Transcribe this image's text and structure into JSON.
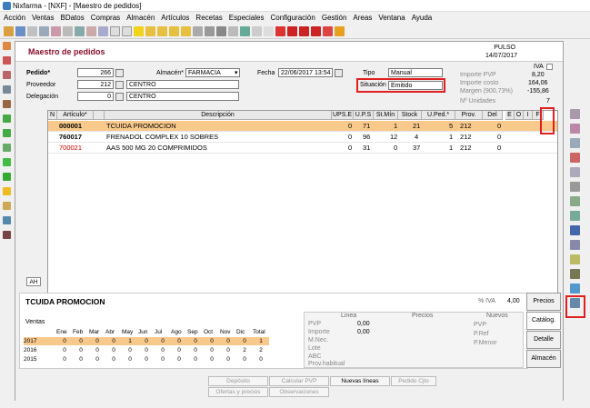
{
  "window": {
    "title": "Nixfarma - [NXF] - [Maestro de pedidos]"
  },
  "menu": [
    "Acción",
    "Ventas",
    "BDatos",
    "Compras",
    "Almacén",
    "Artículos",
    "Recetas",
    "Especiales",
    "Configuración",
    "Gestión",
    "Areas",
    "Ventana",
    "Ayuda"
  ],
  "form": {
    "title": "Maestro de pedidos",
    "user": "PULSO",
    "date": "14/07/2017",
    "pedido_label": "Pedido*",
    "pedido": "266",
    "proveedor_label": "Proveedor",
    "proveedor": "212",
    "proveedor_name": "CENTRO",
    "delegacion_label": "Delegación",
    "delegacion": "0",
    "delegacion_name": "CENTRO",
    "almacen_label": "Almacén*",
    "almacen": "FARMACIA",
    "fecha_label": "Fecha",
    "fecha": "22/06/2017 13:54",
    "tipo_label": "Tipo",
    "tipo": "Manual",
    "situacion_label": "Situación",
    "situacion": "Emitido",
    "iva_label": "IVA",
    "importe_pvp_label": "Importe PVP",
    "importe_pvp": "8,20",
    "importe_costo_label": "Importe costo",
    "importe_costo": "164,06",
    "margen_label": "Margen (900,73%)",
    "margen": "-155,86",
    "unidades_label": "Nº Unidades",
    "unidades": "7"
  },
  "grid": {
    "headers": [
      "N",
      "Artículo*",
      "Descripción",
      "UPS.E",
      "U.P.S",
      "St.Mín",
      "Stock",
      "U.Ped.*",
      "Prov.",
      "Del",
      "E",
      "O",
      "I",
      "F"
    ],
    "rows": [
      {
        "code": "000001",
        "desc": "TCUIDA PROMOCION",
        "upse": "0",
        "ups": "71",
        "stmin": "1",
        "stock": "21",
        "uped": "5",
        "prov": "212",
        "del": "0"
      },
      {
        "code": "760017",
        "desc": "FRENADOL COMPLEX 10 SOBRES",
        "upse": "0",
        "ups": "96",
        "stmin": "12",
        "stock": "4",
        "uped": "1",
        "prov": "212",
        "del": "0"
      },
      {
        "code": "700021",
        "desc": "AAS 500 MG 20 COMPRIMIDOS",
        "upse": "0",
        "ups": "31",
        "stmin": "0",
        "stock": "37",
        "uped": "1",
        "prov": "212",
        "del": "0"
      }
    ],
    "ah_tab": "AH"
  },
  "detail": {
    "title": "TCUIDA PROMOCION",
    "iva_label": "% IVA",
    "iva": "4,00",
    "ventas_label": "Ventas",
    "months": [
      "Ene",
      "Feb",
      "Mar",
      "Abr",
      "May",
      "Jun",
      "Jul",
      "Ago",
      "Sep",
      "Oct",
      "Nov",
      "Dic",
      "Total"
    ],
    "years": [
      {
        "year": "2017",
        "vals": [
          "0",
          "0",
          "0",
          "0",
          "1",
          "0",
          "0",
          "0",
          "0",
          "0",
          "0",
          "0",
          "1"
        ]
      },
      {
        "year": "2016",
        "vals": [
          "0",
          "0",
          "0",
          "0",
          "0",
          "0",
          "0",
          "0",
          "0",
          "0",
          "0",
          "2",
          "2"
        ]
      },
      {
        "year": "2015",
        "vals": [
          "0",
          "0",
          "0",
          "0",
          "0",
          "0",
          "0",
          "0",
          "0",
          "0",
          "0",
          "0",
          "0"
        ]
      }
    ],
    "linea_label": "Linea",
    "precios_label": "Precios",
    "nuevos_label": "Nuevos",
    "pvp_label": "PVP",
    "pvp": "0,00",
    "importe_label": "Importe",
    "importe": "0,00",
    "mnec_label": "M.Nec.",
    "lote_label": "Lote",
    "abc_label": "ABC",
    "prov_habitual_label": "Prov.habitual",
    "n_pvp_label": "PVP",
    "pref_label": "P.Ref",
    "pmenor_label": "P.Menor"
  },
  "tabs": [
    "Precios",
    "Catálog.",
    "Detalle",
    "Almacén"
  ],
  "buttons": {
    "deposito": "Depósito",
    "calcular_pvp": "Calcular PVP",
    "nuevas_lineas": "Nuevas líneas",
    "pedido_cjto": "Pedido Cjto",
    "ofertas": "Ofertas y precios",
    "observaciones": "Observaciones"
  },
  "colors": {
    "accent": "#8b0f2e",
    "highlight_row": "#f9c98c",
    "red_box": "#e02020",
    "year_2017": "#f9c98c"
  }
}
